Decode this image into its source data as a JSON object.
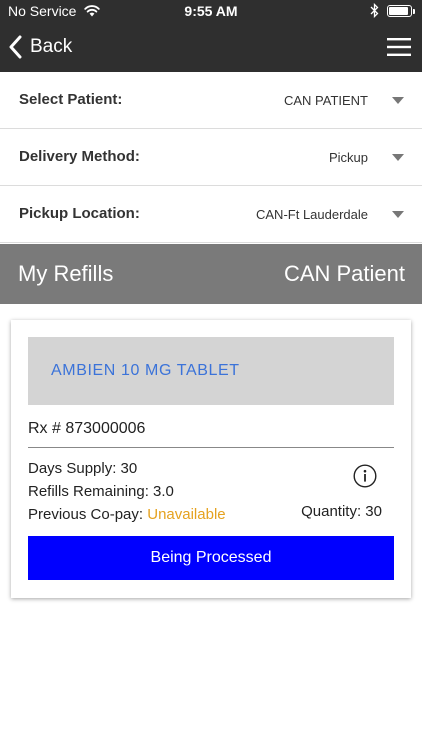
{
  "status_bar": {
    "carrier": "No Service",
    "time": "9:55 AM",
    "battery_level": 0.92
  },
  "nav": {
    "back_label": "Back"
  },
  "selects": {
    "patient": {
      "label": "Select Patient:",
      "value": "CAN PATIENT"
    },
    "delivery": {
      "label": "Delivery Method:",
      "value": "Pickup"
    },
    "location": {
      "label": "Pickup Location:",
      "value": "CAN-Ft Lauderdale"
    }
  },
  "banner": {
    "title": "My Refills",
    "patient": "CAN Patient"
  },
  "refill": {
    "drug_name": "AMBIEN 10 MG TABLET",
    "rx": "Rx # 873000006",
    "days_supply": "Days Supply: 30",
    "refills_remaining": "Refills Remaining: 3.0",
    "copay_label": "Previous Co-pay:",
    "copay_value": "Unavailable",
    "quantity": "Quantity: 30",
    "status_button": "Being Processed"
  },
  "colors": {
    "header_bg": "#2f2f2f",
    "banner_bg": "#7a7a7a",
    "drug_text": "#3b73d9",
    "copay_unavailable": "#e5a21f",
    "status_button_bg": "#0000ff"
  },
  "icons": [
    "wifi-icon",
    "bluetooth-icon",
    "battery-icon",
    "chevron-left-icon",
    "hamburger-menu-icon",
    "dropdown-caret-icon",
    "info-icon"
  ]
}
